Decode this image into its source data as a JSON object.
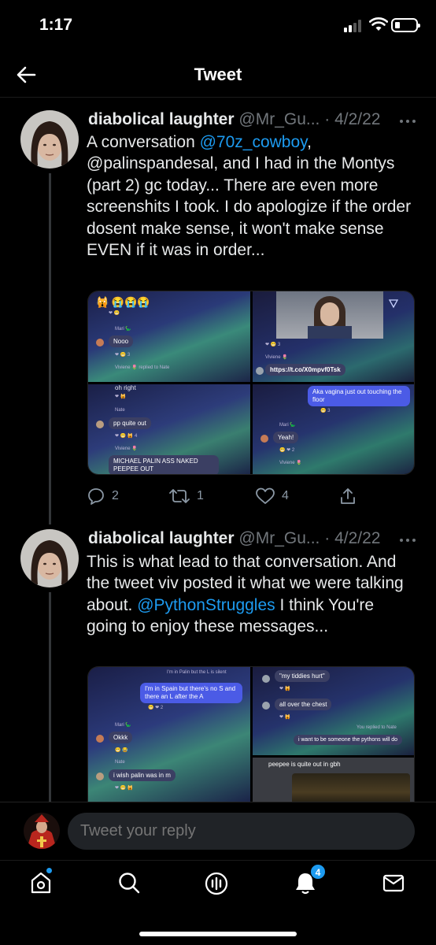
{
  "status_bar": {
    "time": "1:17"
  },
  "header": {
    "title": "Tweet"
  },
  "tweets": [
    {
      "author": "diabolical laughter",
      "handle": "@Mr_Gu...",
      "separator": "·",
      "date": "4/2/22",
      "text": {
        "p1": "A conversation ",
        "m1": "@70z_cowboy",
        "p2": ", @palinspandesal, and I had in the Montys (part 2) gc today... There are even more screenshits I took. I do apologize if the order dosent make sense, it won't make sense EVEN if it was in order..."
      },
      "media": {
        "c1_name": "Mari 🦕",
        "c1_msg": "Nooo",
        "c1_reactions": "❤ 😬 3",
        "c1_reply": "Viviene 🌷 replied to Nate",
        "c2_reactions": "❤ 😬 3",
        "c2_name": "Viviene 🌷",
        "c2_link": "https://t.co/X0mpvf0Tsk",
        "c3_top": "oh right",
        "c3_name": "Nate",
        "c3_msg": "pp quite out",
        "c3_reactions": "❤ 😬 🙀 4",
        "c3_name2": "Viviene 🌷",
        "c3_msg2": "MICHAEL PALIN ASS NAKED PEEPEE OUT",
        "c4_msg": "Aka vagina just out touching the floor",
        "c4_reactions": "😬 3",
        "c4_name": "Mari 🦕",
        "c4_msg2": "Yeah!",
        "c4_reactions2": "😬 ❤ 2",
        "c4_name2": "Viviene 🌷"
      },
      "actions": {
        "replies": "2",
        "retweets": "1",
        "likes": "4"
      }
    },
    {
      "author": "diabolical laughter",
      "handle": "@Mr_Gu...",
      "separator": "·",
      "date": "4/2/22",
      "text": {
        "p1": "This is what lead to that conversation. And the tweet viv posted it what we were talking about. ",
        "m1": "@PythonStruggles",
        "p2": " I think You're going to enjoy these messages..."
      },
      "media": {
        "c1_top": "I'm in Palin but the L is silent",
        "c1_msg": "I'm in Spain but there's no S and there an L after the A",
        "c1_reactions": "😬 ❤ 2",
        "c1_name": "Mari 🦕",
        "c1_msg2": "Okkk",
        "c1_name2": "Nate",
        "c1_msg3": "i wish palin was in m",
        "c2_msg": "\"my tiddies hurt\"",
        "c2_msg2": "all over the chest",
        "c2_reply": "You replied to Nate",
        "c2_msg3": "i want to be someone the pythons will do",
        "c3_msg": "peepee is quite out in gbh"
      }
    }
  ],
  "reply_bar": {
    "placeholder": "Tweet your reply"
  },
  "tab_bar": {
    "notifications_badge": "4"
  },
  "colors": {
    "accent": "#1d9bf0",
    "background": "#000000",
    "muted": "#71767b"
  }
}
